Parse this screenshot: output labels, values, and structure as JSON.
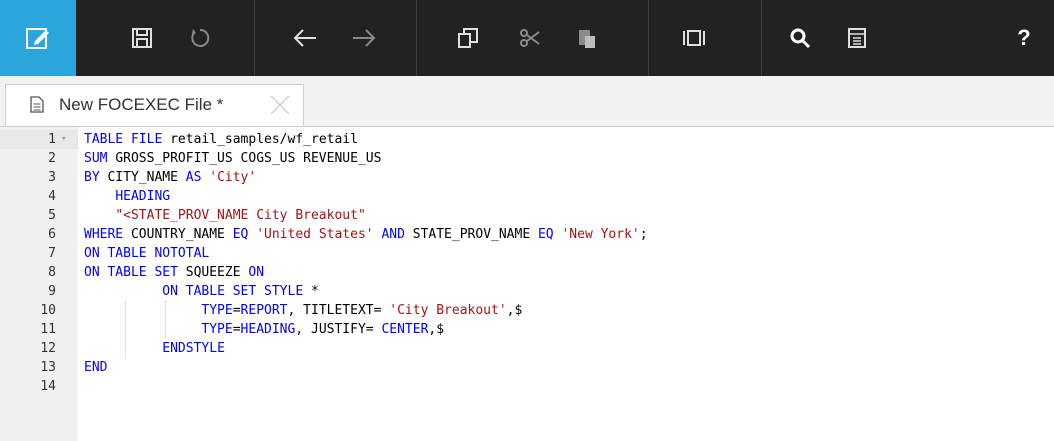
{
  "toolbar": {
    "icons": [
      "edit-icon",
      "save-icon",
      "undo-icon",
      "back-arrow-icon",
      "forward-arrow-icon",
      "copy-icon",
      "cut-icon",
      "paste-icon",
      "panel-icon",
      "search-icon",
      "report-icon",
      "help-icon"
    ],
    "accent_color": "#2aa6dc",
    "help_label": "?"
  },
  "tab": {
    "label": "New FOCEXEC File *"
  },
  "editor": {
    "lines": [
      {
        "n": "1",
        "tokens": [
          [
            "kw",
            "TABLE FILE"
          ],
          [
            "",
            ""
          ],
          [
            "",
            "retail_samples/wf_retail"
          ]
        ]
      },
      {
        "n": "2",
        "tokens": [
          [
            "kw",
            "SUM"
          ],
          [
            "",
            "GROSS_PROFIT_US COGS_US REVENUE_US"
          ]
        ]
      },
      {
        "n": "3",
        "tokens": [
          [
            "kw",
            "BY"
          ],
          [
            "",
            "CITY_NAME"
          ],
          [
            "kw",
            "AS"
          ],
          [
            "str",
            "'City'"
          ]
        ]
      },
      {
        "n": "4",
        "tokens": [
          [
            "kw",
            "HEADING"
          ]
        ]
      },
      {
        "n": "5",
        "tokens": [
          [
            "str",
            "\"<STATE_PROV_NAME City Breakout\""
          ]
        ]
      },
      {
        "n": "6",
        "tokens": [
          [
            "kw",
            "WHERE"
          ],
          [
            "",
            "COUNTRY_NAME"
          ],
          [
            "kw",
            "EQ"
          ],
          [
            "str",
            "'United States'"
          ],
          [
            "kw",
            "AND"
          ],
          [
            "",
            "STATE_PROV_NAME"
          ],
          [
            "kw",
            "EQ"
          ],
          [
            "str",
            "'New York'"
          ],
          [
            "",
            ";"
          ]
        ]
      },
      {
        "n": "7",
        "tokens": [
          [
            "kw",
            "ON TABLE NOTOTAL"
          ]
        ]
      },
      {
        "n": "8",
        "tokens": [
          [
            "kw",
            "ON TABLE SET"
          ],
          [
            "",
            "SQUEEZE"
          ],
          [
            "kw",
            "ON"
          ]
        ]
      },
      {
        "n": "9",
        "tokens": [
          [
            "kw",
            "ON TABLE SET STYLE"
          ],
          [
            "",
            "*"
          ]
        ]
      },
      {
        "n": "10",
        "tokens": [
          [
            "kw",
            "TYPE"
          ],
          [
            "",
            "="
          ],
          [
            "kw",
            "REPORT"
          ],
          [
            "",
            ", TITLETEXT="
          ],
          [
            "str",
            "'City Breakout'"
          ],
          [
            "",
            ",$"
          ]
        ]
      },
      {
        "n": "11",
        "tokens": [
          [
            "kw",
            "TYPE"
          ],
          [
            "",
            "="
          ],
          [
            "kw",
            "HEADING"
          ],
          [
            "",
            ", JUSTIFY="
          ],
          [
            "kw",
            "CENTER"
          ],
          [
            "",
            ",$"
          ]
        ]
      },
      {
        "n": "12",
        "tokens": [
          [
            "kw",
            "ENDSTYLE"
          ]
        ]
      },
      {
        "n": "13",
        "tokens": [
          [
            "kw",
            "END"
          ]
        ]
      },
      {
        "n": "14",
        "tokens": []
      }
    ]
  }
}
